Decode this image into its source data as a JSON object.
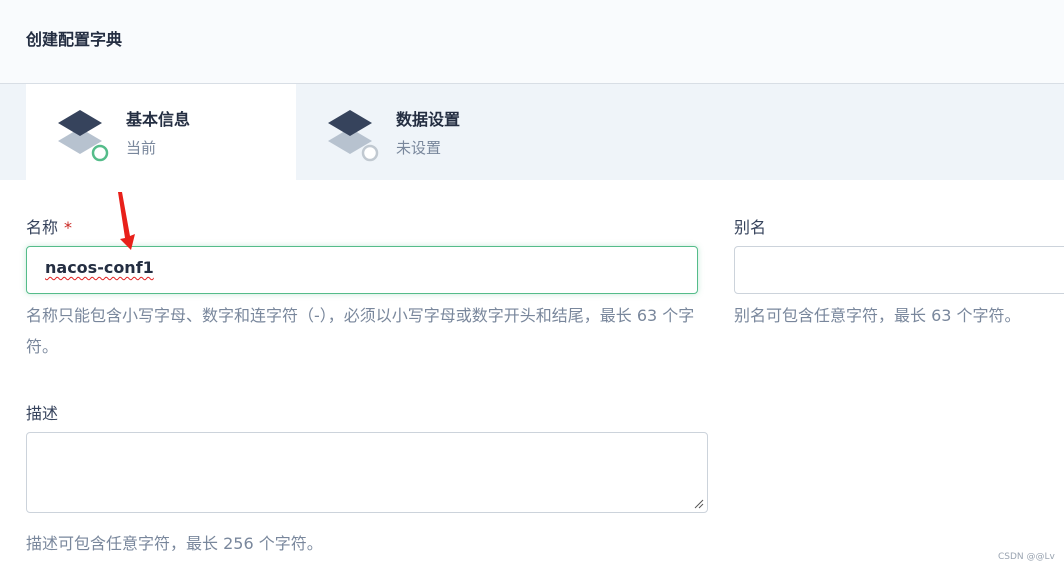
{
  "page": {
    "title": "创建配置字典"
  },
  "tabs": [
    {
      "title": "基本信息",
      "status": "当前",
      "active": true
    },
    {
      "title": "数据设置",
      "status": "未设置",
      "active": false
    }
  ],
  "form": {
    "name": {
      "label": "名称",
      "required_mark": "*",
      "value": "nacos-conf1",
      "help": "名称只能包含小写字母、数字和连字符（-），必须以小写字母或数字开头和结尾，最长 63 个字符。"
    },
    "alias": {
      "label": "别名",
      "value": "",
      "help": "别名可包含任意字符，最长 63 个字符。"
    },
    "description": {
      "label": "描述",
      "value": "",
      "help": "描述可包含任意字符，最长 256 个字符。"
    }
  },
  "colors": {
    "accent_green": "#55bc8a",
    "arrow_red": "#e8201a",
    "required_red": "#ca2621"
  },
  "icons": {
    "tab_icon": "layers-icon",
    "status_done": "status-current-circle-icon",
    "status_pending": "status-pending-circle-icon",
    "annotation": "red-arrow-icon"
  },
  "watermark": "CSDN @@Lv"
}
